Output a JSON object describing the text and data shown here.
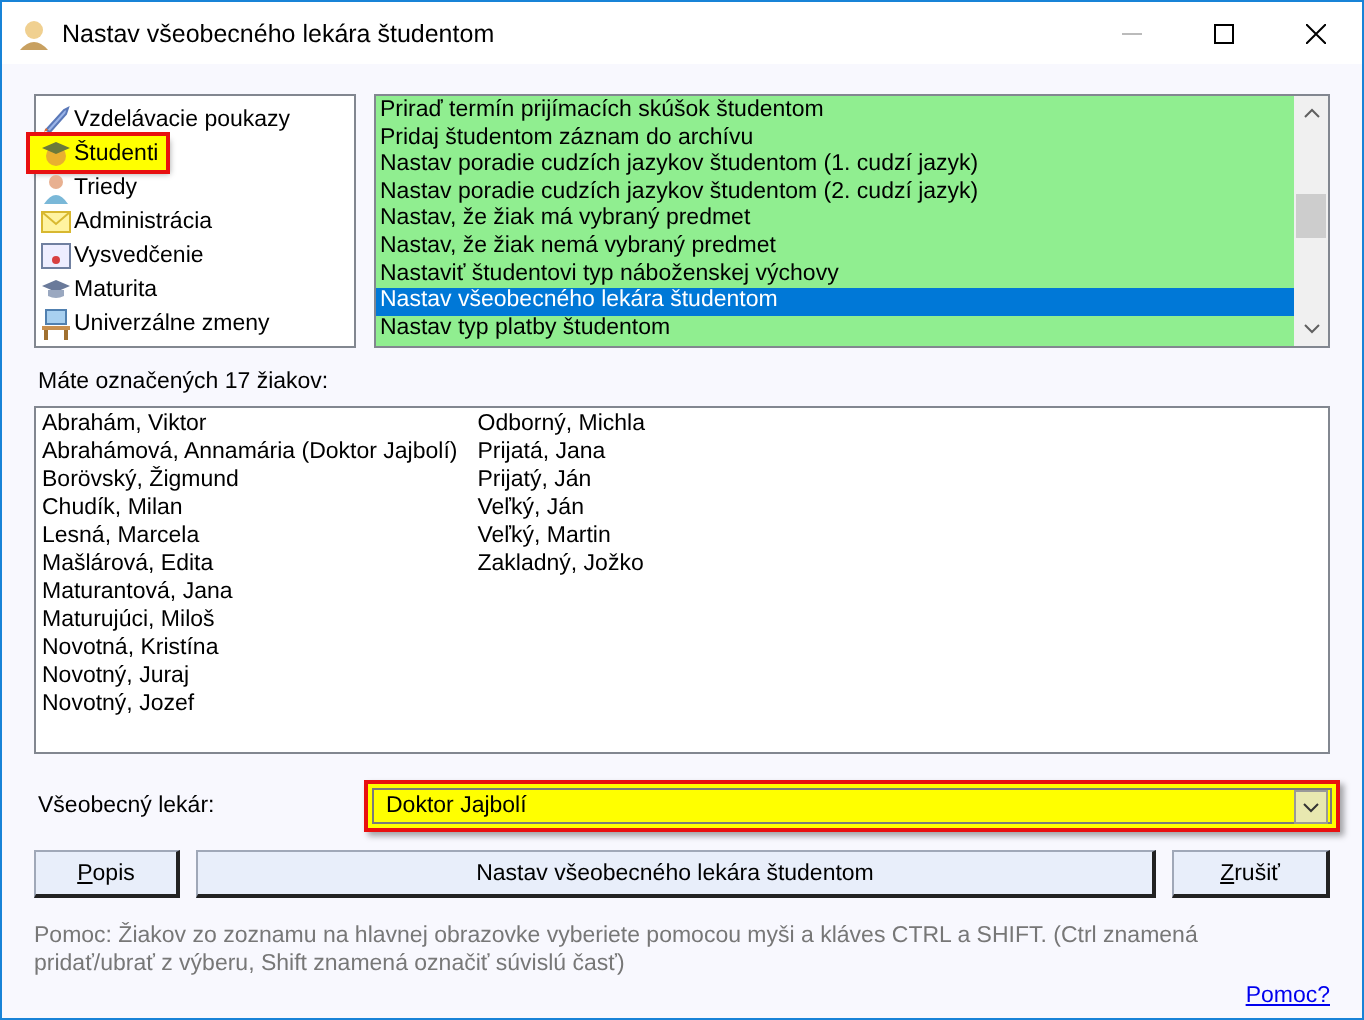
{
  "window": {
    "title": "Nastav všeobecného lekára študentom"
  },
  "categories": [
    {
      "label": "Vzdelávacie poukazy",
      "selected": false
    },
    {
      "label": "Študenti",
      "selected": true
    },
    {
      "label": "Triedy",
      "selected": false
    },
    {
      "label": "Administrácia",
      "selected": false
    },
    {
      "label": "Vysvedčenie",
      "selected": false
    },
    {
      "label": "Maturita",
      "selected": false
    },
    {
      "label": "Univerzálne zmeny",
      "selected": false
    }
  ],
  "actions": [
    {
      "label": "Priraď termín prijímacích skúšok študentom",
      "selected": false
    },
    {
      "label": "Pridaj študentom záznam do archívu",
      "selected": false
    },
    {
      "label": "Nastav poradie cudzích jazykov študentom (1. cudzí jazyk)",
      "selected": false
    },
    {
      "label": "Nastav poradie cudzích jazykov študentom (2. cudzí jazyk)",
      "selected": false
    },
    {
      "label": "Nastav, že žiak má vybraný predmet",
      "selected": false
    },
    {
      "label": "Nastav, že žiak nemá vybraný predmet",
      "selected": false
    },
    {
      "label": "Nastaviť študentovi typ náboženskej výchovy",
      "selected": false
    },
    {
      "label": "Nastav všeobecného lekára študentom",
      "selected": true
    },
    {
      "label": "Nastav typ platby študentom",
      "selected": false
    }
  ],
  "students_label": "Máte označených 17 žiakov:",
  "students": [
    "Abrahám, Viktor",
    "Abrahámová, Annamária (Doktor Jajbolí)",
    "Borövský, Žigmund",
    "Chudík, Milan",
    "Lesná, Marcela",
    "Mašlárová, Edita",
    "Maturantová, Jana",
    "Maturujúci, Miloš",
    "Novotná, Kristína",
    "Novotný, Juraj",
    "Novotný, Jozef",
    "Odborný, Michla",
    "Prijatá, Jana",
    "Prijatý, Ján",
    "Veľký, Ján",
    "Veľký, Martin",
    "Zakladný, Jožko"
  ],
  "doctor": {
    "label": "Všeobecný lekár:",
    "value": "Doktor Jajbolí"
  },
  "buttons": {
    "describe": "Popis",
    "apply": "Nastav všeobecného lekára študentom",
    "cancel": "Zrušiť"
  },
  "help": "Pomoc: Žiakov zo zoznamu na hlavnej obrazovke vyberiete pomocou myši a kláves CTRL a SHIFT. (Ctrl znamená pridať/ubrať z výberu, Shift znamená označiť súvislú časť)",
  "help_link": "Pomoc?"
}
